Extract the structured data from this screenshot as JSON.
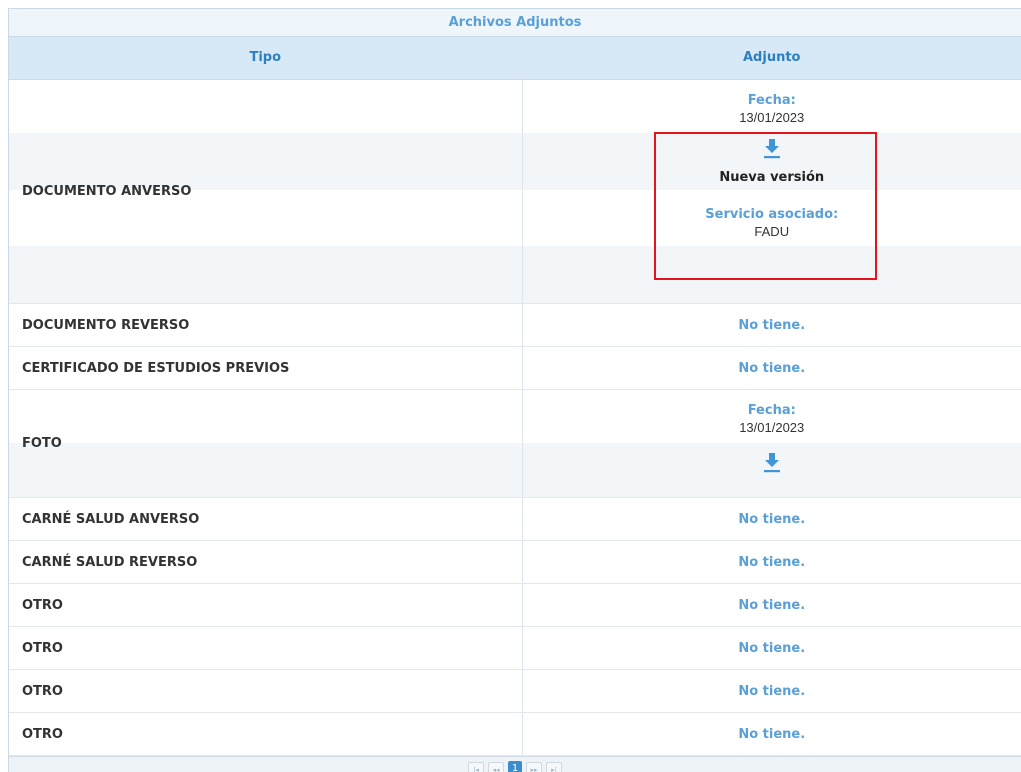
{
  "caption": "Archivos Adjuntos",
  "headers": {
    "tipo": "Tipo",
    "adjunto": "Adjunto"
  },
  "rows": [
    {
      "tipo": "DOCUMENTO ANVERSO",
      "fecha_label": "Fecha:",
      "fecha": "13/01/2023",
      "nueva_version": "Nueva versión",
      "servicio_label": "Servicio asociado:",
      "servicio": "FADU"
    },
    {
      "tipo": "DOCUMENTO REVERSO",
      "adjunto": "No tiene."
    },
    {
      "tipo": "CERTIFICADO DE ESTUDIOS PREVIOS",
      "adjunto": "No tiene."
    },
    {
      "tipo": "FOTO",
      "fecha_label": "Fecha:",
      "fecha": "13/01/2023"
    },
    {
      "tipo": "CARNÉ SALUD ANVERSO",
      "adjunto": "No tiene."
    },
    {
      "tipo": "CARNÉ SALUD REVERSO",
      "adjunto": "No tiene."
    },
    {
      "tipo": "OTRO",
      "adjunto": "No tiene."
    },
    {
      "tipo": "OTRO",
      "adjunto": "No tiene."
    },
    {
      "tipo": "OTRO",
      "adjunto": "No tiene."
    },
    {
      "tipo": "OTRO",
      "adjunto": "No tiene."
    }
  ],
  "pager": {
    "first": "|◂",
    "prev": "◂◂",
    "current": "1",
    "next": "▸▸",
    "last": "▸|"
  },
  "colors": {
    "accent": "#5aa0d6",
    "header_bg": "#d7e9f7",
    "highlight": "#e3141b"
  },
  "icons": {
    "download": "download-arrow-icon"
  }
}
